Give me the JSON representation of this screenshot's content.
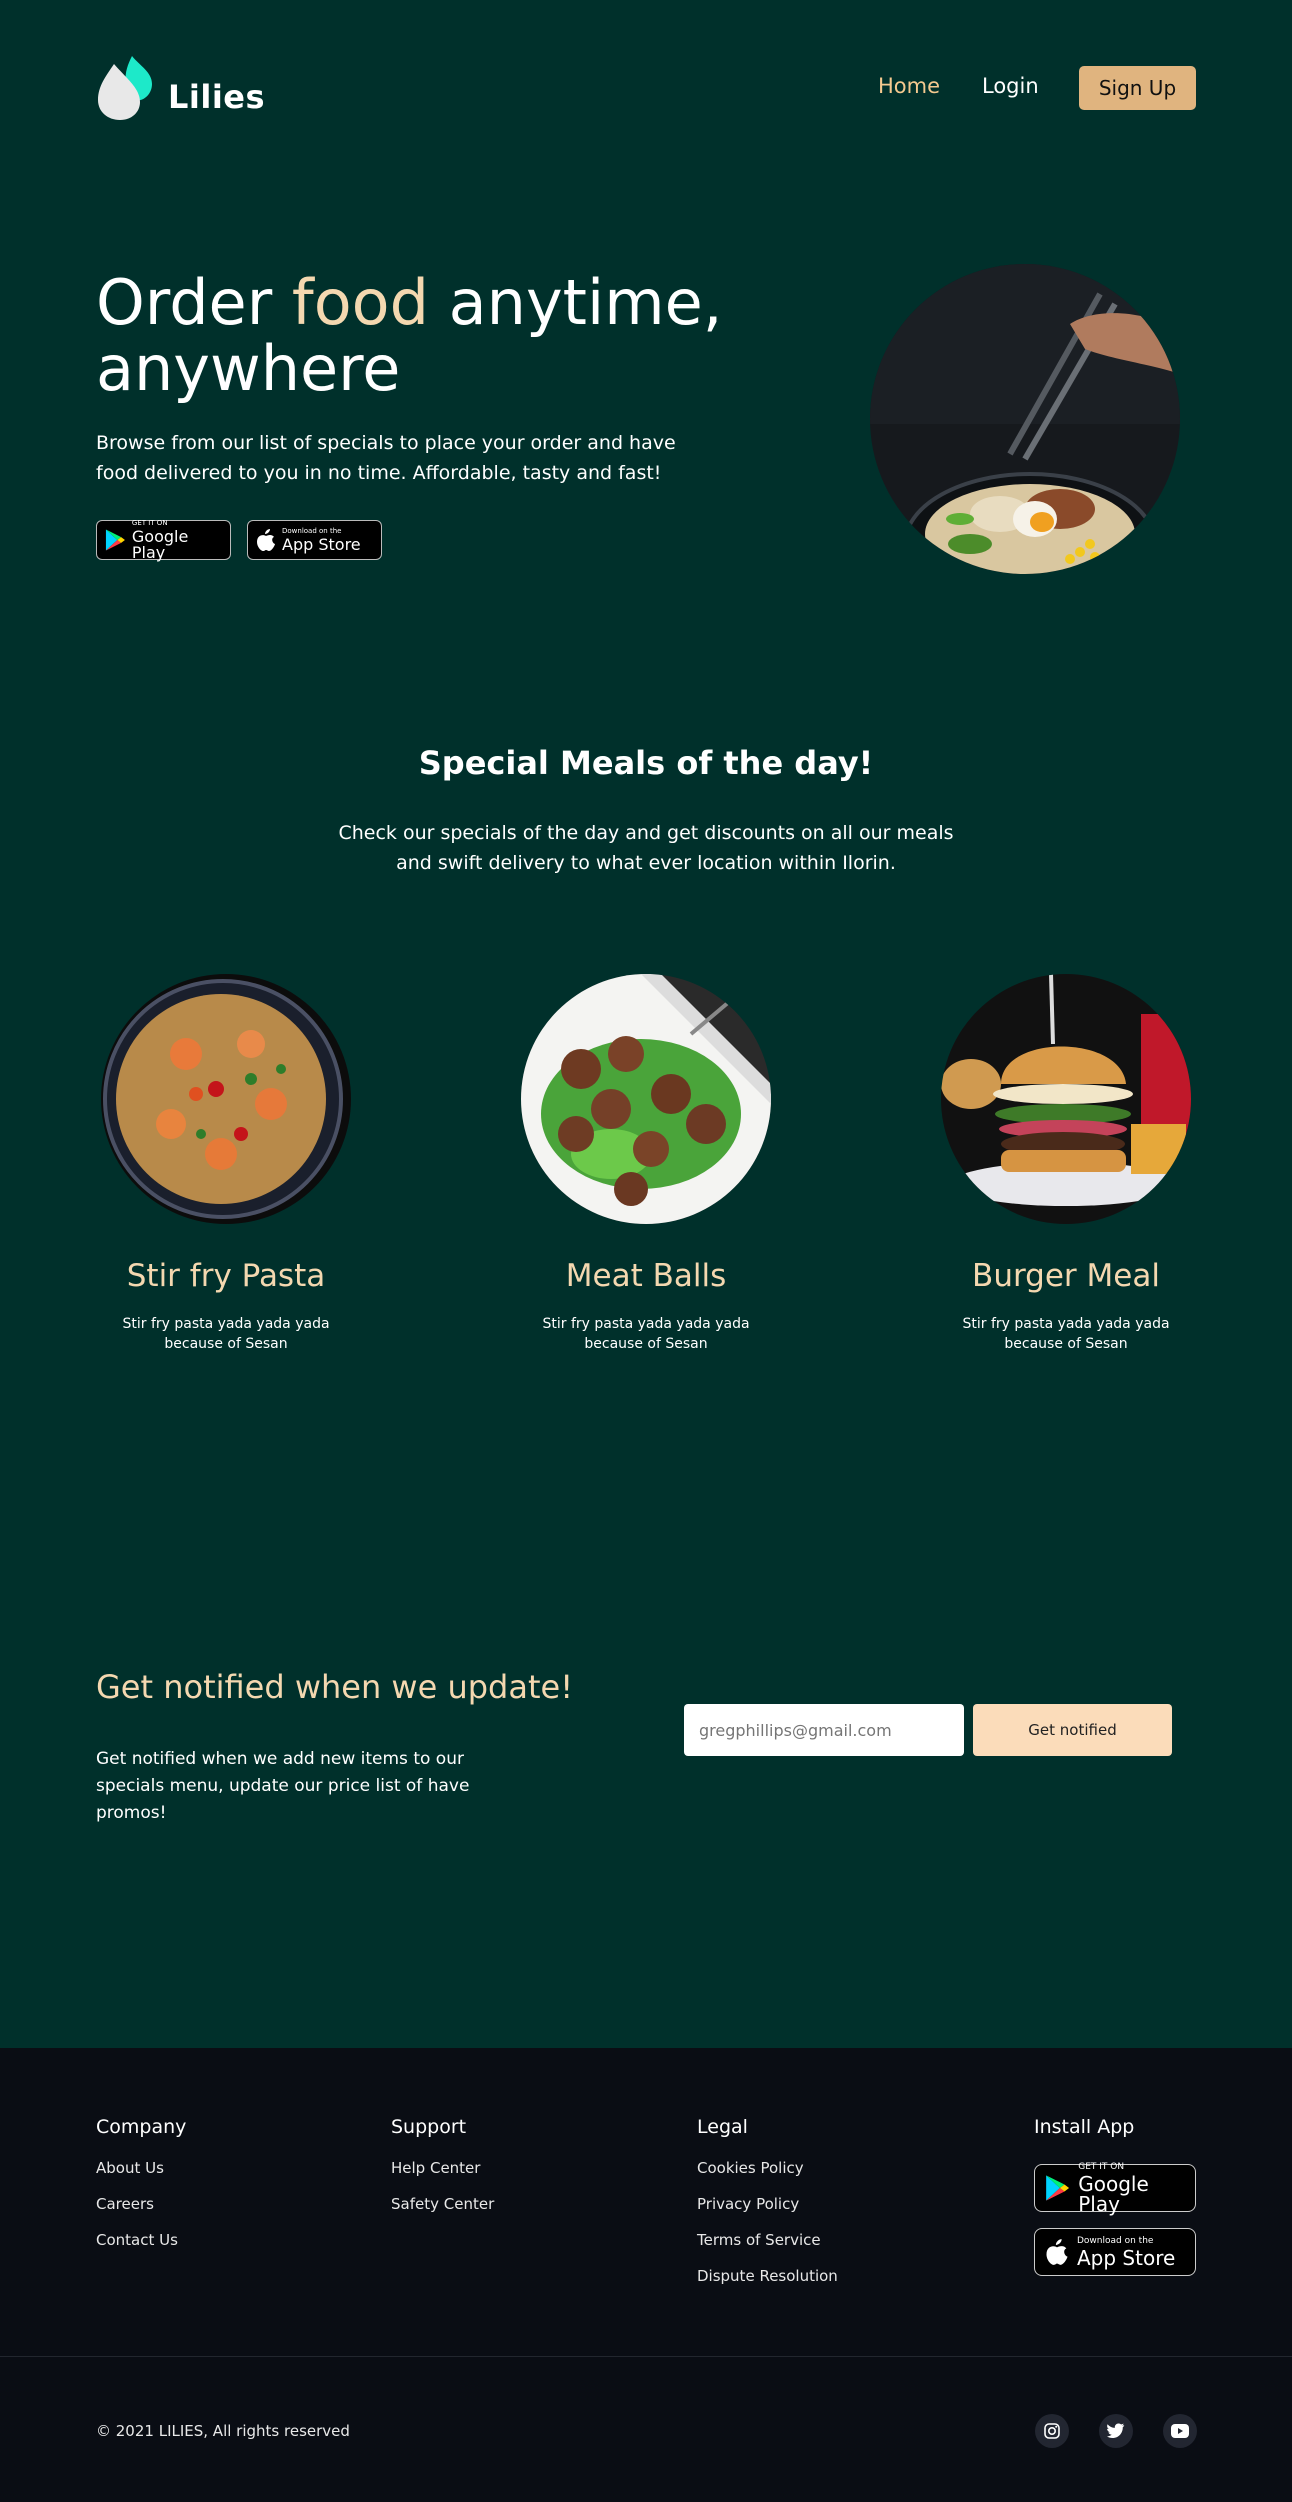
{
  "header": {
    "brand": "Lilies",
    "nav": {
      "home": "Home",
      "login": "Login",
      "signup": "Sign Up"
    }
  },
  "hero": {
    "title_part1": "Order ",
    "title_accent": "food",
    "title_part2": " anytime, anywhere",
    "description": "Browse from our list of specials to place your order and have food delivered to you in no time. Affordable, tasty and fast!",
    "google_play": {
      "small": "GET IT ON",
      "big": "Google Play"
    },
    "app_store": {
      "small": "Download on the",
      "big": "App Store"
    }
  },
  "specials": {
    "title": "Special Meals of the day!",
    "description": "Check our specials of the day and get discounts on all our meals and swift delivery to what ever location within Ilorin.",
    "meals": [
      {
        "name": "Stir fry Pasta",
        "description": "Stir fry pasta yada yada yada because of Sesan"
      },
      {
        "name": "Meat Balls",
        "description": "Stir fry pasta yada yada yada because of Sesan"
      },
      {
        "name": "Burger Meal",
        "description": "Stir fry pasta yada yada yada because of Sesan"
      }
    ]
  },
  "notify": {
    "title": "Get notified when we update!",
    "description": "Get notified when we add new items to our specials menu, update our price list of have promos!",
    "email_placeholder": "gregphillips@gmail.com",
    "button": "Get notified"
  },
  "footer": {
    "company": {
      "heading": "Company",
      "links": [
        "About Us",
        "Careers",
        "Contact Us"
      ]
    },
    "support": {
      "heading": "Support",
      "links": [
        "Help Center",
        "Safety Center"
      ]
    },
    "legal": {
      "heading": "Legal",
      "links": [
        "Cookies Policy",
        "Privacy Policy",
        "Terms of Service",
        "Dispute Resolution"
      ]
    },
    "install": {
      "heading": "Install App",
      "google_play": {
        "small": "GET IT ON",
        "big": "Google Play"
      },
      "app_store": {
        "small": "Download on the",
        "big": "App Store"
      }
    },
    "copyright": "© 2021 LILIES, All rights reserved",
    "social": [
      "instagram-icon",
      "twitter-icon",
      "youtube-icon"
    ]
  },
  "colors": {
    "background": "#00302b",
    "accent": "#f4d8b0",
    "button": "#e0b47f",
    "footer": "#0a0d14"
  }
}
